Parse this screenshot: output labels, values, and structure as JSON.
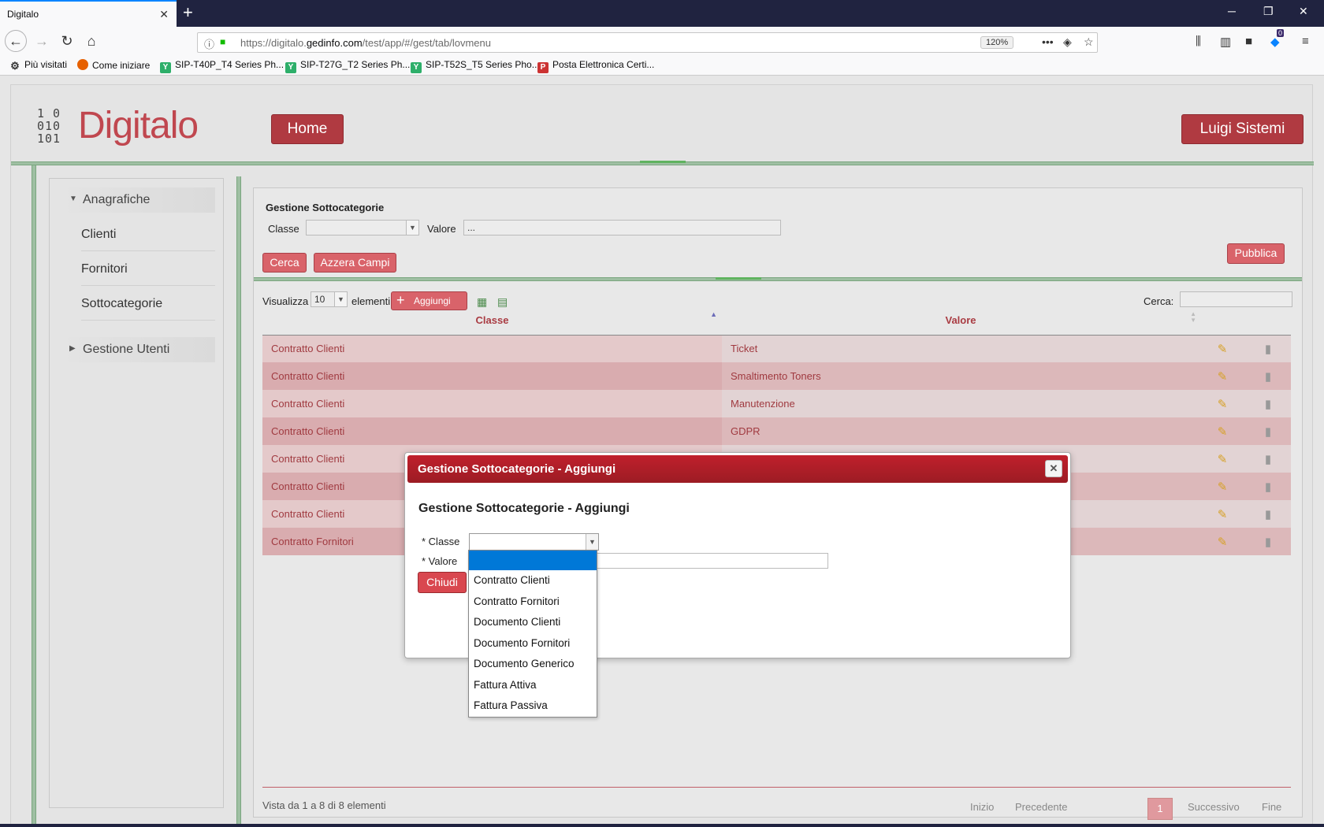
{
  "browser": {
    "tab_title": "Digitalo",
    "tab_close": "✕",
    "new_tab": "+",
    "url_prefix": "https://digitalo.",
    "url_domain": "gedinfo.com",
    "url_path": "/test/app/#/gest/tab/lovmenu",
    "zoom": "120%",
    "bookmarks": [
      {
        "label": "Più visitati",
        "icon": "gear-icon"
      },
      {
        "label": "Come iniziare",
        "icon": "firefox-icon"
      },
      {
        "label": "SIP-T40P_T4 Series Ph...",
        "icon": "yealink-icon"
      },
      {
        "label": "SIP-T27G_T2 Series Ph...",
        "icon": "yealink-icon"
      },
      {
        "label": "SIP-T52S_T5 Series Pho...",
        "icon": "yealink-icon"
      },
      {
        "label": "Posta Elettronica Certi...",
        "icon": "pec-icon"
      }
    ],
    "notification_count": "0"
  },
  "app": {
    "logo_bits": "1 0\n010\n101",
    "logo_text": "Digitalo",
    "home_label": "Home",
    "user_label": "Luigi Sistemi"
  },
  "sidebar": {
    "groups": [
      {
        "label": "Anagrafiche",
        "expanded": true,
        "items": [
          "Clienti",
          "Fornitori",
          "Sottocategorie"
        ]
      },
      {
        "label": "Gestione Utenti",
        "expanded": false,
        "items": []
      }
    ]
  },
  "filters": {
    "title": "Gestione Sottocategorie",
    "classe_label": "Classe",
    "classe_value": "",
    "valore_label": "Valore",
    "valore_value": "...",
    "cerca_label": "Cerca",
    "azzera_label": "Azzera Campi",
    "pubblica_label": "Pubblica"
  },
  "table_toolbar": {
    "visualizza_label": "Visualizza",
    "page_size": "10",
    "elementi_label": "elementi",
    "aggiungi_label": "Aggiungi",
    "search_label": "Cerca:",
    "search_value": ""
  },
  "table": {
    "columns": [
      "Classe",
      "Valore"
    ],
    "rows": [
      {
        "classe": "Contratto Clienti",
        "valore": "Ticket"
      },
      {
        "classe": "Contratto Clienti",
        "valore": "Smaltimento Toners"
      },
      {
        "classe": "Contratto Clienti",
        "valore": "Manutenzione"
      },
      {
        "classe": "Contratto Clienti",
        "valore": "GDPR"
      },
      {
        "classe": "Contratto Clienti",
        "valore": ""
      },
      {
        "classe": "Contratto Clienti",
        "valore": ""
      },
      {
        "classe": "Contratto Clienti",
        "valore": ""
      },
      {
        "classe": "Contratto Fornitori",
        "valore": ""
      }
    ]
  },
  "footer": {
    "info": "Vista da 1 a 8 di 8 elementi",
    "first": "Inizio",
    "prev": "Precedente",
    "current": "1",
    "next": "Successivo",
    "last": "Fine"
  },
  "modal": {
    "title": "Gestione Sottocategorie - Aggiungi",
    "heading": "Gestione Sottocategorie - Aggiungi",
    "close_glyph": "✕",
    "classe_label": "* Classe",
    "valore_label": "* Valore",
    "chiudi_label": "Chiudi",
    "options": [
      "",
      "Contratto Clienti",
      "Contratto Fornitori",
      "Documento Clienti",
      "Documento Fornitori",
      "Documento Generico",
      "Fattura Attiva",
      "Fattura Passiva"
    ],
    "highlighted_option": ""
  },
  "colors": {
    "brand_red": "#b03a41",
    "accent_green": "#9fbfa3",
    "row_odd": "#e2d3d4",
    "row_even": "#dcb8ba",
    "selection_blue": "#0078d7"
  }
}
